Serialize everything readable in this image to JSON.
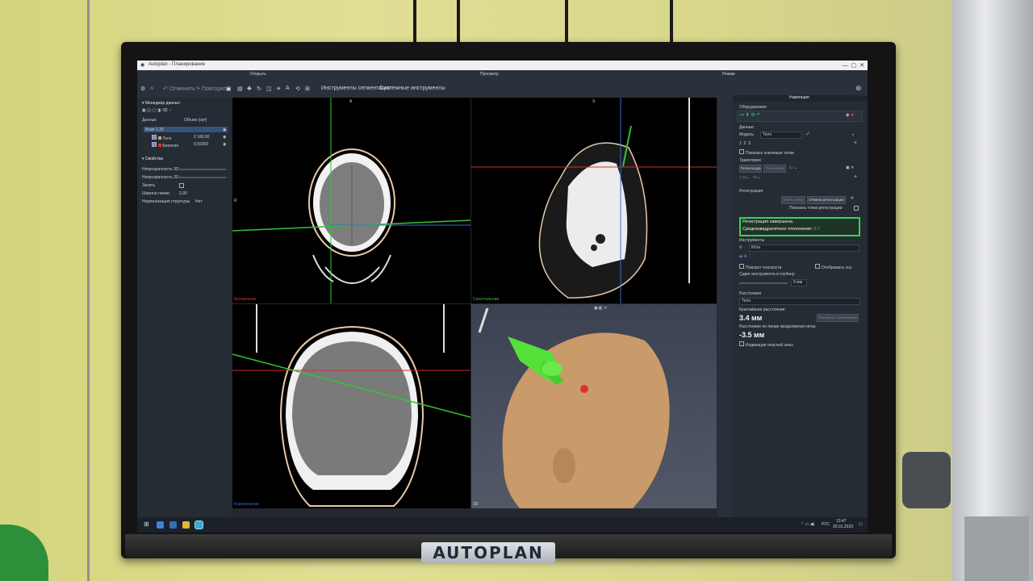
{
  "window": {
    "title": "Autoplan - Планирование"
  },
  "menu": {
    "section_open": "Открыть",
    "section_view": "Просмотр",
    "section_modes": "Режим",
    "undo": "Отменить",
    "redo": "Повторить",
    "segmentation_tools": "Инструменты сегментации",
    "system_tools": "Системные инструменты"
  },
  "left_panel": {
    "data_manager": "Менеджер данных",
    "col_data": "Данные",
    "col_volume": "Объем (см³)",
    "items": [
      {
        "name": "Brain 1.25",
        "volume": ""
      },
      {
        "name": "Тело",
        "volume": "2 180,00"
      },
      {
        "name": "Биопсия",
        "volume": "0,59259"
      }
    ],
    "properties": "Свойства",
    "opacity_3d": "Непрозрачность 3D",
    "opacity_2d": "Непрозрачность 2D",
    "fill": "Залить",
    "border_width": "Ширина линии",
    "border_width_value": "2,00",
    "orientation": "Нормализация структуры",
    "orientation_value": "Нет"
  },
  "viewports": {
    "axial": "Аксиальная",
    "sagittal": "Сагиттальная",
    "coronal": "Корональная",
    "label_3d": "3D"
  },
  "right_panel": {
    "header": "Навигация",
    "equipment": "Оборудование",
    "data": "Данные",
    "model_label": "Модель",
    "model_value": "Тело",
    "show_key_points": "Показать ключевые точки",
    "trajectory": "Траектория",
    "entry_point": "Точка входа",
    "target_point": "Точка цели",
    "registration": "Регистрация",
    "add_point": "Взять точку",
    "cancel_registration": "Отмена регистрации",
    "show_reg_points": "Показать точки регистрации",
    "reg_done": "Регистрация завершена.",
    "rms_label": "Среднеквадратичное отклонение:",
    "rms_value": "0.7",
    "instruments": "Инструменты",
    "instrument_value": "Игла",
    "rotate_plane": "Поворот плоскости",
    "show_axis": "Отображать ось",
    "depth_shift": "Сдвиг инструмента в глубину:",
    "depth_value": "0 мм",
    "distance": "Расстояния",
    "distance_target": "Тело",
    "shortest_distance": "Кратчайшее расстояние:",
    "shortest_value": "3.4 мм",
    "line_distance": "Расстояние по линии продолжения иглы:",
    "line_value": "-3.5 мм",
    "indicate_zone": "Индикация опасной зоны",
    "build_trajectory": "Построить траекторию"
  },
  "taskbar": {
    "lang": "РУС",
    "time": "13:47",
    "date": "20.01.2023"
  },
  "brand": "AUTOPLAN",
  "colors": {
    "accent_green": "#38d25a",
    "panel": "#262c34",
    "selected": "#34537a"
  }
}
